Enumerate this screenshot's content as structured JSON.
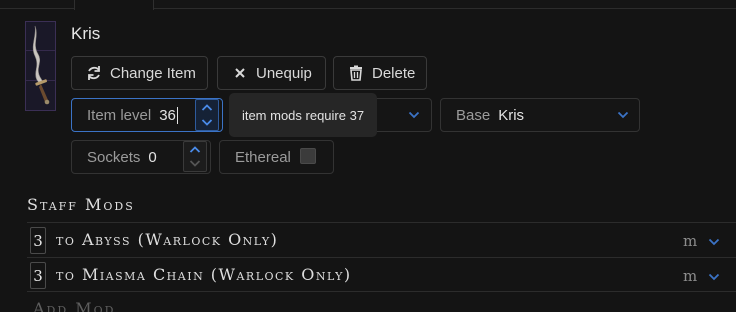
{
  "item": {
    "name": "Kris"
  },
  "actions": {
    "change_item": "Change Item",
    "unequip": "Unequip",
    "delete": "Delete"
  },
  "fields": {
    "item_level_label": "Item level",
    "item_level_value": "36",
    "base_label": "Base",
    "base_value": "Kris",
    "sockets_label": "Sockets",
    "sockets_value": "0",
    "ethereal_label": "Ethereal",
    "ethereal_checked": false
  },
  "tooltip": {
    "text": "item mods require 37"
  },
  "mods": {
    "section_title": "Staff Mods",
    "items": [
      {
        "value": "3",
        "text": "to Abyss (Warlock Only)",
        "badge": "m"
      },
      {
        "value": "3",
        "text": "to Miasma Chain (Warlock Only)",
        "badge": "m"
      }
    ],
    "add_label": "Add Mod"
  },
  "colors": {
    "accent": "#3b73c6",
    "background": "#141414"
  }
}
